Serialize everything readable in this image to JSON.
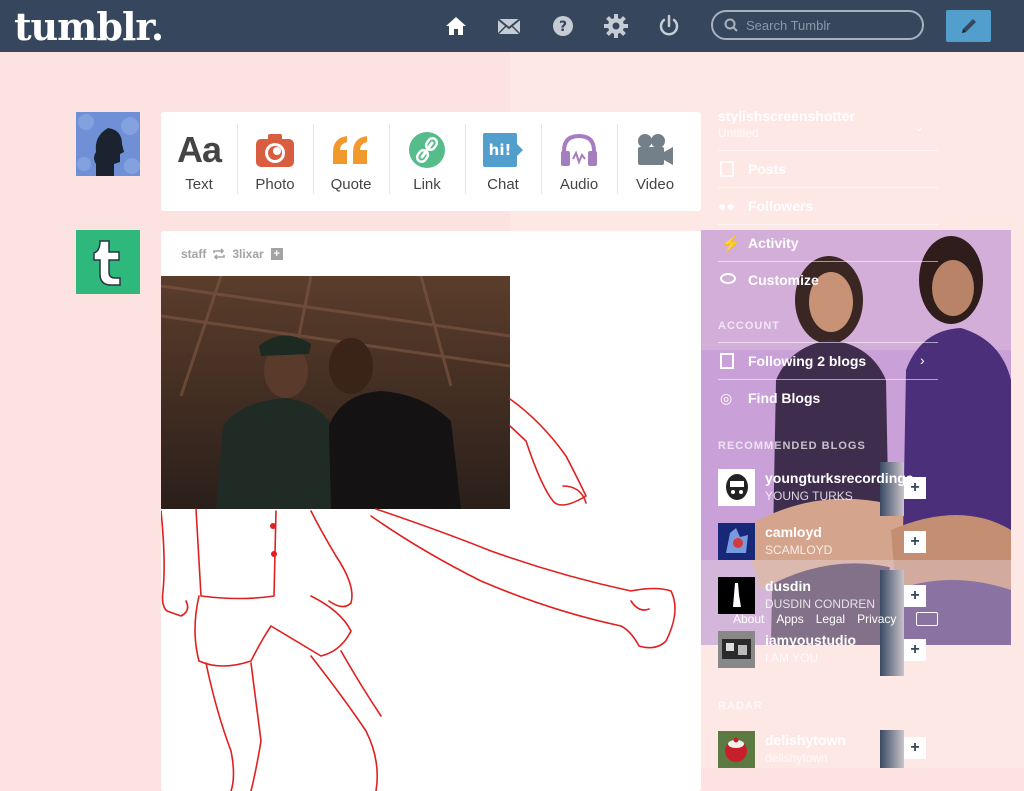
{
  "header": {
    "logo": "tumblr.",
    "search_placeholder": "Search Tumblr",
    "nav_icons": [
      "home-icon",
      "mail-icon",
      "help-icon",
      "gear-icon",
      "power-icon"
    ],
    "accent": "#36465d",
    "compose_color": "#529ecc"
  },
  "post_types": [
    {
      "label": "Text",
      "icon": "text-icon",
      "color": "#444444"
    },
    {
      "label": "Photo",
      "icon": "camera-icon",
      "color": "#d95e40"
    },
    {
      "label": "Quote",
      "icon": "quote-icon",
      "color": "#f2992e"
    },
    {
      "label": "Link",
      "icon": "link-icon",
      "color": "#56bc8a"
    },
    {
      "label": "Chat",
      "icon": "chat-icon",
      "color": "#529ecc"
    },
    {
      "label": "Audio",
      "icon": "headphones-icon",
      "color": "#a77dc2"
    },
    {
      "label": "Video",
      "icon": "video-camera-icon",
      "color": "#748089"
    }
  ],
  "post": {
    "author": "staff",
    "reblogged_from": "3lixar"
  },
  "sidebar": {
    "blog_name": "stylishscreenshotter",
    "blog_sub": "Untitled",
    "items": [
      {
        "label": "Posts",
        "icon": "posts-icon"
      },
      {
        "label": "Followers",
        "icon": "followers-icon"
      },
      {
        "label": "Activity",
        "icon": "activity-icon"
      },
      {
        "label": "Customize",
        "icon": "customize-icon"
      }
    ],
    "account_header": "ACCOUNT",
    "account_items": [
      {
        "label": "Following 2 blogs"
      },
      {
        "label": "Find Blogs"
      }
    ],
    "recommended_header": "RECOMMENDED BLOGS",
    "recommended": [
      {
        "name": "youngturksrecordings",
        "sub": "YOUNG TURKS"
      },
      {
        "name": "camloyd",
        "sub": "SCAMLOYD"
      },
      {
        "name": "dusdin",
        "sub": "DUSDIN CONDREN"
      },
      {
        "name": "iamyoustudio",
        "sub": "I AM YOU"
      }
    ],
    "footer_links": [
      "About",
      "Apps",
      "Legal",
      "Privacy"
    ],
    "radar_header": "RADAR",
    "radar": {
      "name": "delishytown",
      "sub": "delishytown"
    }
  }
}
